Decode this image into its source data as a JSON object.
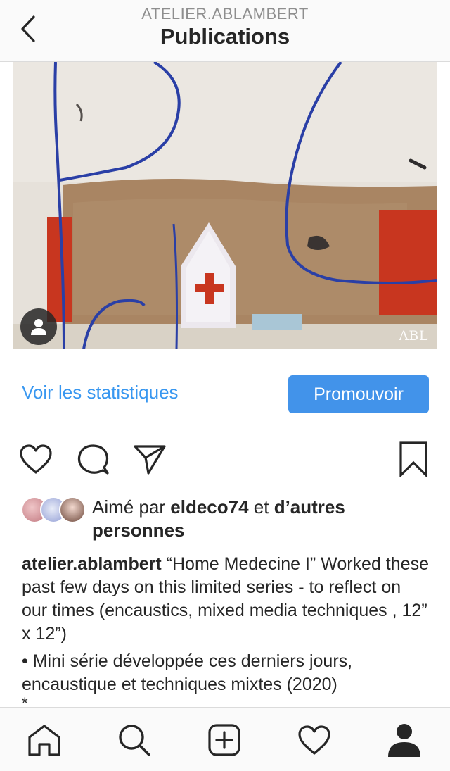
{
  "header": {
    "account": "ATELIER.ABLAMBERT",
    "title": "Publications"
  },
  "post": {
    "signature": "ABL",
    "stats_link": "Voir les statistiques",
    "promote_button": "Promouvoir",
    "likes": {
      "prefix": "Aimé par ",
      "liker": "eldeco74",
      "middle": " et ",
      "others": "d’autres personnes"
    },
    "caption": {
      "username": "atelier.ablambert",
      "line1": " “Home Medecine I” Worked these past few days on this limited series - to reflect on our times (encaustics, mixed media techniques , 12” x 12”)",
      "line2": "• Mini série développée ces derniers jours, encaustique et techniques mixtes (2020)",
      "line3": "*"
    }
  },
  "icons": {
    "back": "chevron-left-icon",
    "like": "heart-icon",
    "comment": "comment-icon",
    "share": "paper-plane-icon",
    "save": "bookmark-icon",
    "user_tag": "person-icon"
  },
  "colors": {
    "accent": "#3897f0",
    "promote": "#4293ea",
    "text": "#262626",
    "muted": "#8e8e8e"
  }
}
